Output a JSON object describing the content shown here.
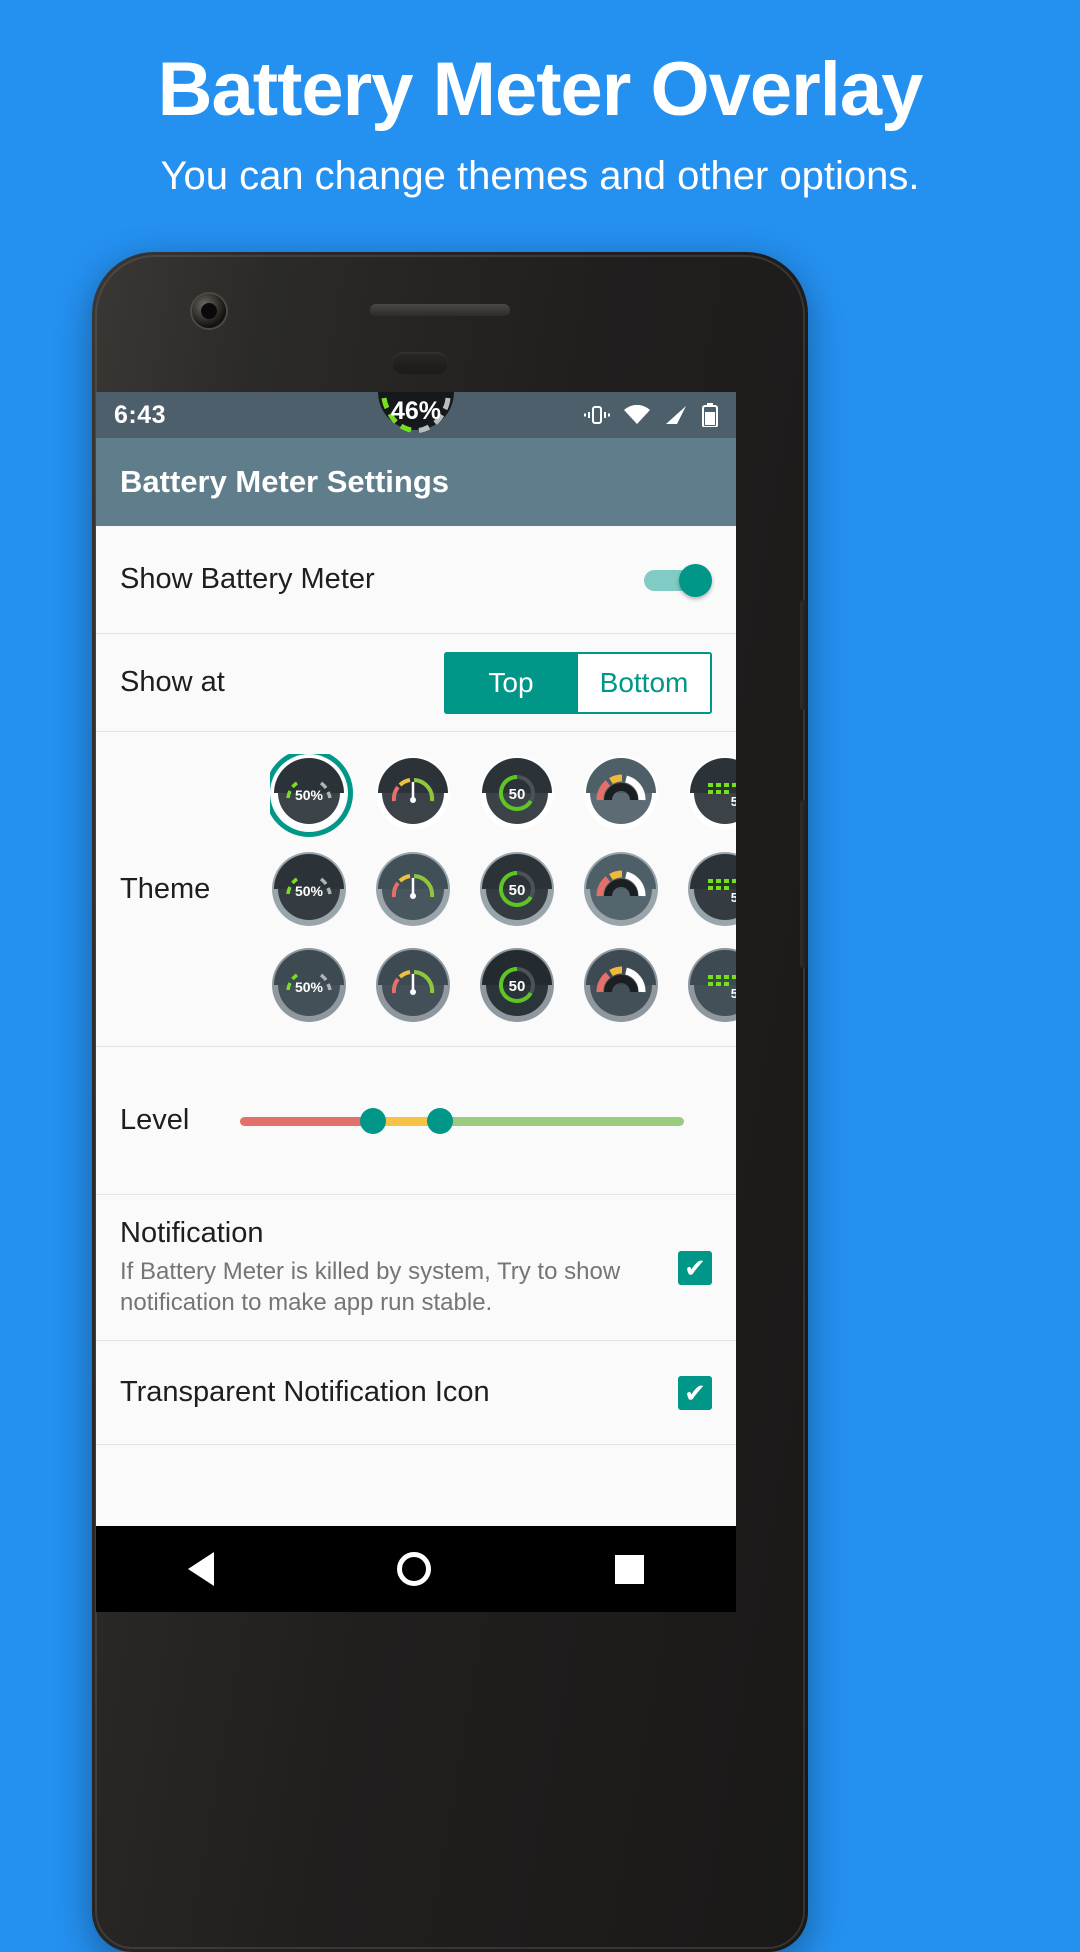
{
  "promo": {
    "title": "Battery Meter Overlay",
    "subtitle": "You can change  themes and other options.",
    "background_color": "#2490f0"
  },
  "phone": {
    "status_bar": {
      "time": "6:43",
      "battery_overlay_percent": "46%",
      "icons": [
        "vibrate-icon",
        "wifi-icon",
        "signal-icon",
        "battery-icon"
      ],
      "background_color": "#4c5f6b"
    },
    "app_bar": {
      "title": "Battery Meter Settings",
      "background_color": "#607d8b"
    },
    "settings": {
      "show_battery_meter": {
        "label": "Show Battery Meter",
        "enabled": true
      },
      "show_at": {
        "label": "Show at",
        "options": [
          "Top",
          "Bottom"
        ],
        "selected": "Top"
      },
      "theme": {
        "label": "Theme",
        "selected_index": 0,
        "sample_value": "50%",
        "sample_value_short": "50",
        "rows": [
          [
            {
              "style": "dashed-arc-pct",
              "bg": "#2b3338",
              "ring": "#ffffff",
              "selected": true
            },
            {
              "style": "needle-gauge",
              "bg": "#2b3338",
              "ring": "#ffffff",
              "selected": false
            },
            {
              "style": "ring-number",
              "bg": "#2b3338",
              "ring": "#ffffff",
              "selected": false
            },
            {
              "style": "thick-arc",
              "bg": "#4f5f68",
              "ring": "#ffffff",
              "selected": false
            },
            {
              "style": "dotted-bar",
              "bg": "#2b3338",
              "ring": "#ffffff",
              "selected": false
            }
          ],
          [
            {
              "style": "dashed-arc-pct",
              "bg": "#2b3338",
              "ring": "#9aa5ab",
              "selected": false
            },
            {
              "style": "needle-gauge",
              "bg": "#414f57",
              "ring": "#9aa5ab",
              "selected": false
            },
            {
              "style": "ring-number",
              "bg": "#2b3338",
              "ring": "#9aa5ab",
              "selected": false
            },
            {
              "style": "thick-arc",
              "bg": "#4f5f68",
              "ring": "#9aa5ab",
              "selected": false
            },
            {
              "style": "dotted-bar",
              "bg": "#2b3338",
              "ring": "#9aa5ab",
              "selected": false
            }
          ],
          [
            {
              "style": "dashed-arc-pct",
              "bg": "#3d4a52",
              "ring": "#8e989e",
              "selected": false
            },
            {
              "style": "needle-gauge",
              "bg": "#3d4a52",
              "ring": "#8e989e",
              "selected": false
            },
            {
              "style": "ring-number",
              "bg": "#232b30",
              "ring": "#8e989e",
              "selected": false
            },
            {
              "style": "thick-arc",
              "bg": "#3d4a52",
              "ring": "#8e989e",
              "selected": false
            },
            {
              "style": "dotted-bar",
              "bg": "#3d4a52",
              "ring": "#8e989e",
              "selected": false
            }
          ]
        ]
      },
      "level": {
        "label": "Level",
        "thumb_positions": [
          30,
          45
        ],
        "colors": {
          "low": "#e2706b",
          "mid": "#f6c344",
          "high": "#9bcc7d",
          "thumb": "#009688"
        }
      },
      "notification": {
        "title": "Notification",
        "description": "If Battery Meter is killed by system, Try to show notification to make app run stable.",
        "checked": true,
        "check_glyph": "✔"
      },
      "transparent_notification_icon": {
        "label": "Transparent Notification Icon",
        "checked": true,
        "check_glyph": "✔"
      }
    },
    "nav_bar": {
      "items": [
        "back-icon",
        "home-icon",
        "recents-icon"
      ]
    }
  },
  "accent_color": "#009688"
}
